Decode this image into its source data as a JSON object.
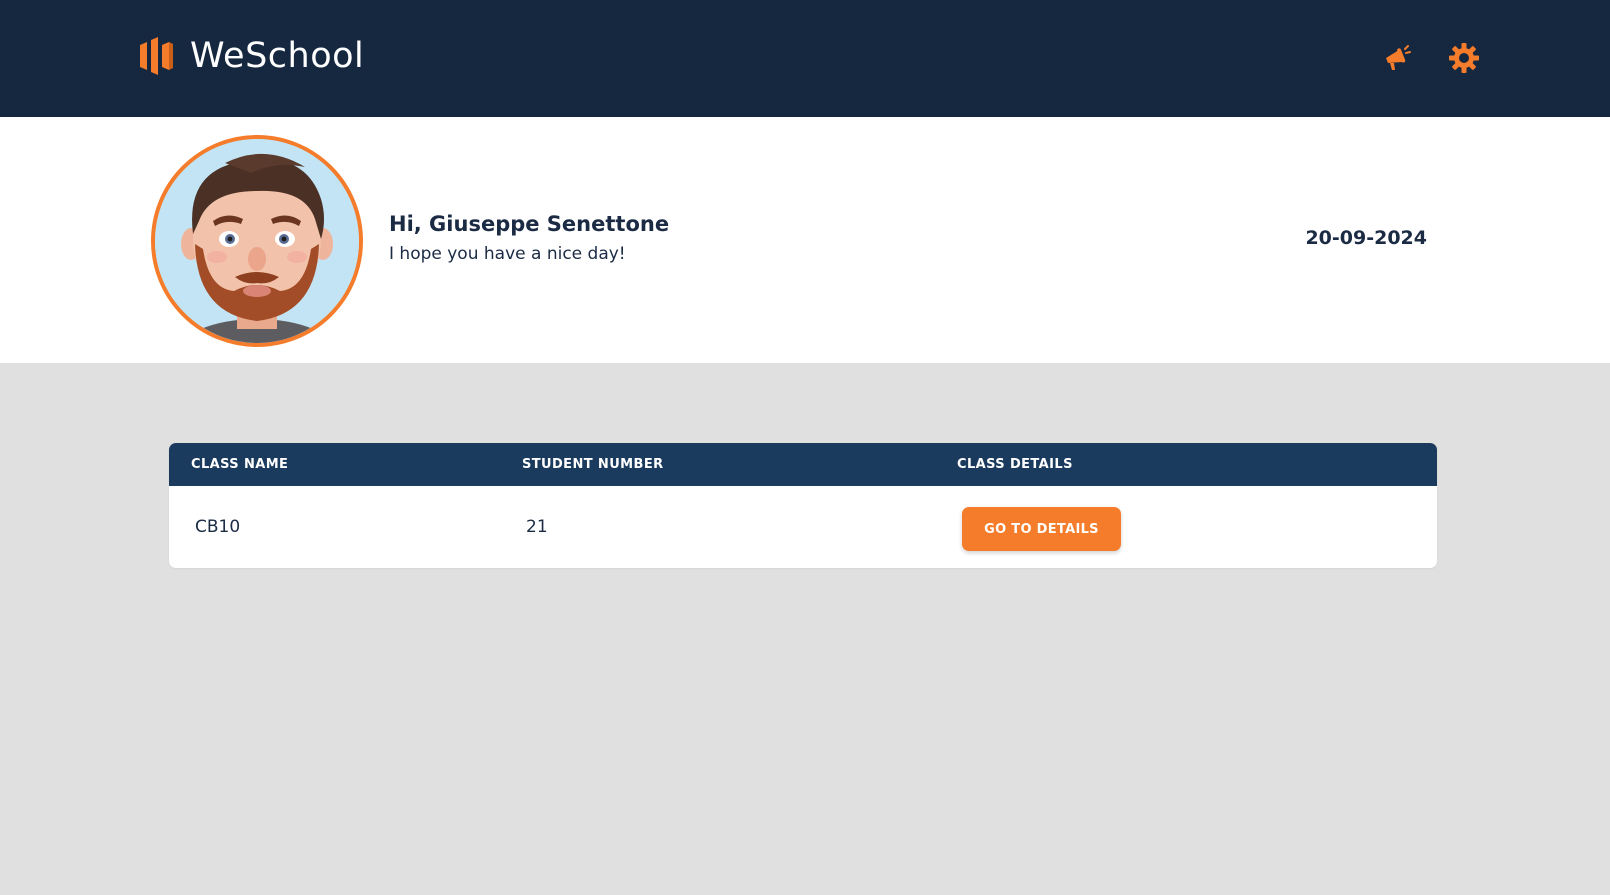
{
  "header": {
    "brand_name": "WeSchool",
    "logo_icon": "weschool-logo-icon",
    "announcements_icon": "megaphone-icon",
    "settings_icon": "gear-icon",
    "bar_color": "#152840",
    "accent_color": "#f47c2a"
  },
  "profile": {
    "avatar": "user-avatar-image",
    "greeting": "Hi, Giuseppe Senettone",
    "subtitle": "I hope you have a nice day!",
    "date": "20-09-2024"
  },
  "classes_table": {
    "columns": [
      "CLASS NAME",
      "STUDENT NUMBER",
      "CLASS DETAILS"
    ],
    "rows": [
      {
        "class_name": "CB10",
        "student_number": "21",
        "details_button_label": "GO TO DETAILS"
      }
    ],
    "header_color": "#1a3a5e"
  }
}
